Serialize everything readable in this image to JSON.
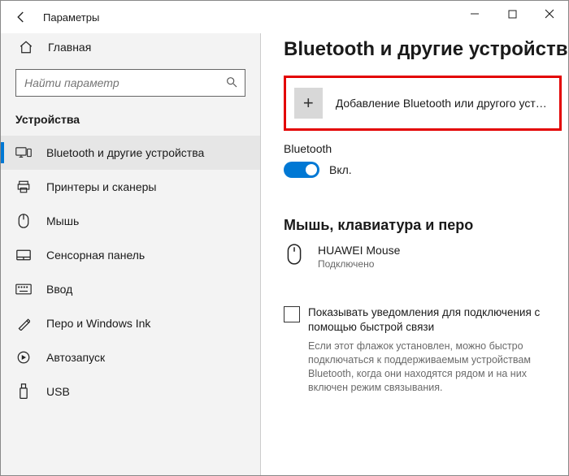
{
  "window": {
    "title": "Параметры"
  },
  "sidebar": {
    "home": "Главная",
    "search_placeholder": "Найти параметр",
    "section": "Устройства",
    "items": [
      {
        "label": "Bluetooth и другие устройства"
      },
      {
        "label": "Принтеры и сканеры"
      },
      {
        "label": "Мышь"
      },
      {
        "label": "Сенсорная панель"
      },
      {
        "label": "Ввод"
      },
      {
        "label": "Перо и Windows Ink"
      },
      {
        "label": "Автозапуск"
      },
      {
        "label": "USB"
      }
    ]
  },
  "main": {
    "heading": "Bluetooth и другие устройства",
    "add_device": "Добавление Bluetooth или другого устройс…",
    "bt_label": "Bluetooth",
    "bt_state": "Вкл.",
    "section2": "Мышь, клавиатура и перо",
    "device": {
      "name": "HUAWEI  Mouse",
      "status": "Подключено"
    },
    "checkbox": "Показывать уведомления для подключения с помощью быстрой связи",
    "help": "Если этот флажок установлен, можно быстро подключаться к поддерживаемым устройствам Bluetooth, когда они находятся рядом и на них включен режим связывания."
  }
}
